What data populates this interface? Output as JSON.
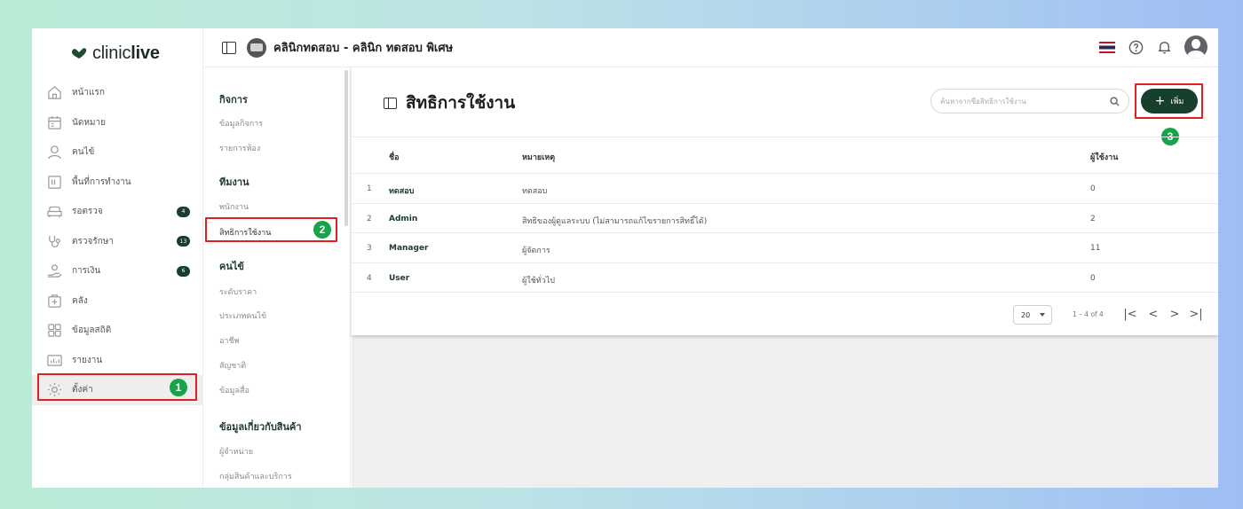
{
  "brand": {
    "logo_pre": "clinic",
    "logo_bold": "live"
  },
  "topbar": {
    "clinic_name": "คลินิกทดสอบ - คลินิก ทดสอบ พิเศษ"
  },
  "sidebar": {
    "items": [
      {
        "label": "หน้าแรก",
        "icon": "home-icon"
      },
      {
        "label": "นัดหมาย",
        "icon": "calendar-icon"
      },
      {
        "label": "คนไข้",
        "icon": "person-icon"
      },
      {
        "label": "พื้นที่การทำงาน",
        "icon": "workspace-icon"
      },
      {
        "label": "รอตรวจ",
        "icon": "sofa-icon",
        "badge": "4"
      },
      {
        "label": "ตรวจรักษา",
        "icon": "stethoscope-icon",
        "badge": "13"
      },
      {
        "label": "การเงิน",
        "icon": "payment-icon",
        "badge": "6"
      },
      {
        "label": "คลัง",
        "icon": "inventory-icon"
      },
      {
        "label": "ข้อมูลสถิติ",
        "icon": "statistics-icon"
      },
      {
        "label": "รายงาน",
        "icon": "report-icon"
      },
      {
        "label": "ตั้งค่า",
        "icon": "gear-icon"
      }
    ]
  },
  "submenu": {
    "groups": [
      {
        "title": "กิจการ",
        "items": [
          "ข้อมูลกิจการ",
          "รายการห้อง"
        ]
      },
      {
        "title": "ทีมงาน",
        "items": [
          "พนักงาน",
          "สิทธิการใช้งาน"
        ]
      },
      {
        "title": "คนไข้",
        "items": [
          "ระดับราคา",
          "ประเภทคนไข้",
          "อาชีพ",
          "สัญชาติ",
          "ข้อมูลสื่อ"
        ]
      },
      {
        "title": "ข้อมูลเกี่ยวกับสินค้า",
        "items": [
          "ผู้จำหน่าย",
          "กลุ่มสินค้าและบริการ"
        ]
      }
    ]
  },
  "page": {
    "title": "สิทธิการใช้งาน",
    "search_placeholder": "ค้นหาจากชื่อสิทธิการใช้งาน",
    "add_label": "เพิ่ม"
  },
  "table": {
    "columns": [
      "ชื่อ",
      "หมายเหตุ",
      "ผู้ใช้งาน"
    ],
    "rows": [
      {
        "idx": "1",
        "name": "ทดสอบ",
        "note": "ทดสอบ",
        "users": "0"
      },
      {
        "idx": "2",
        "name": "Admin",
        "note": "สิทธิของผู้ดูแลระบบ (ไม่สามารถแก้ไขรายการสิทธิ์ได้)",
        "users": "2"
      },
      {
        "idx": "3",
        "name": "Manager",
        "note": "ผู้จัดการ",
        "users": "11"
      },
      {
        "idx": "4",
        "name": "User",
        "note": "ผู้ใช้ทั่วไป",
        "users": "0"
      }
    ]
  },
  "pagination": {
    "page_size": "20",
    "range": "1 – 4 of 4"
  },
  "annotations": {
    "step1": "1",
    "step2": "2",
    "step3": "3"
  },
  "colors": {
    "brand_dark_green": "#16402b",
    "step_green": "#16a34a",
    "highlight_red": "#e02020"
  }
}
